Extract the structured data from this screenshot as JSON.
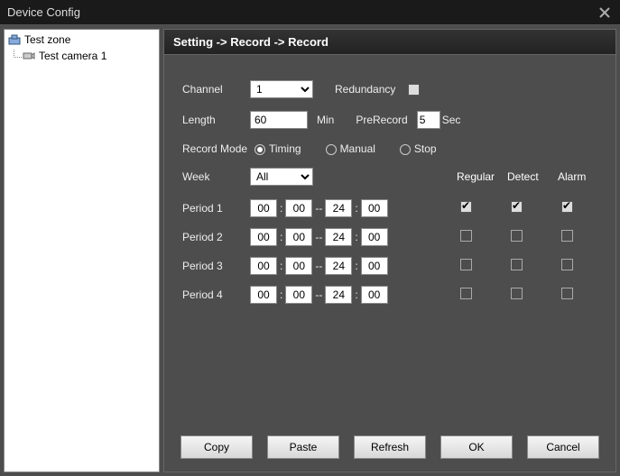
{
  "window": {
    "title": "Device Config"
  },
  "tree": {
    "root": {
      "label": "Test zone"
    },
    "child": {
      "label": "Test camera 1"
    }
  },
  "breadcrumb": "Setting -> Record -> Record",
  "labels": {
    "channel": "Channel",
    "redundancy": "Redundancy",
    "length": "Length",
    "min": "Min",
    "prerecord": "PreRecord",
    "sec": "Sec",
    "recordmode": "Record Mode",
    "timing": "Timing",
    "manual": "Manual",
    "stop": "Stop",
    "week": "Week",
    "regular": "Regular",
    "detect": "Detect",
    "alarm": "Alarm",
    "period1": "Period 1",
    "period2": "Period 2",
    "period3": "Period 3",
    "period4": "Period 4"
  },
  "values": {
    "channel": "1",
    "length": "60",
    "prerecord": "5",
    "week": "All",
    "redundancy_checked": false,
    "mode": "timing"
  },
  "periods": [
    {
      "h1": "00",
      "m1": "00",
      "h2": "24",
      "m2": "00",
      "regular": true,
      "detect": true,
      "alarm": true
    },
    {
      "h1": "00",
      "m1": "00",
      "h2": "24",
      "m2": "00",
      "regular": false,
      "detect": false,
      "alarm": false
    },
    {
      "h1": "00",
      "m1": "00",
      "h2": "24",
      "m2": "00",
      "regular": false,
      "detect": false,
      "alarm": false
    },
    {
      "h1": "00",
      "m1": "00",
      "h2": "24",
      "m2": "00",
      "regular": false,
      "detect": false,
      "alarm": false
    }
  ],
  "buttons": {
    "copy": "Copy",
    "paste": "Paste",
    "refresh": "Refresh",
    "ok": "OK",
    "cancel": "Cancel"
  }
}
